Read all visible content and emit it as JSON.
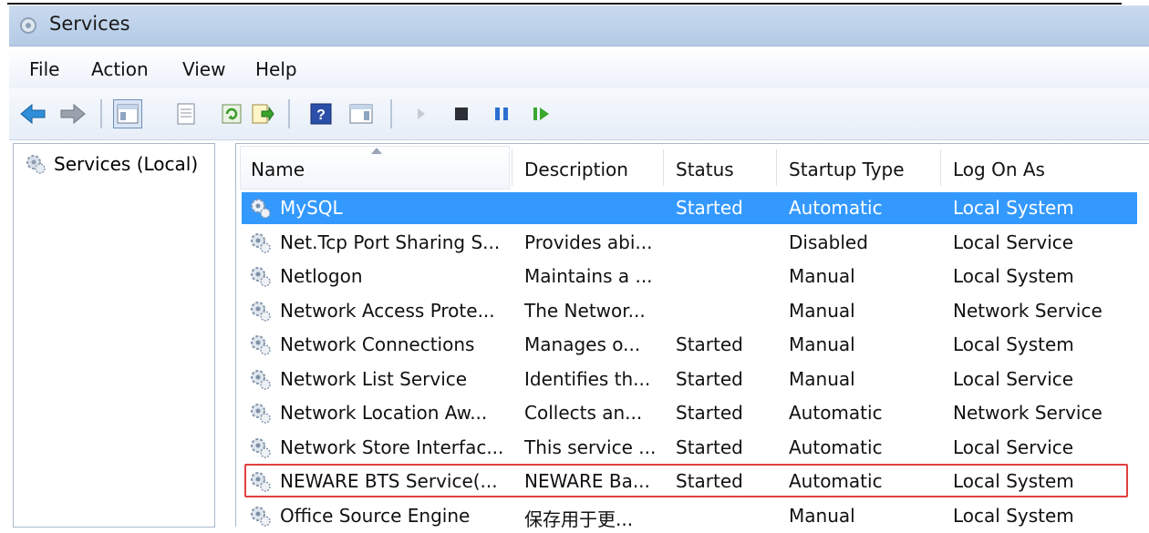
{
  "window": {
    "title": "Services"
  },
  "menu": [
    "File",
    "Action",
    "View",
    "Help"
  ],
  "left_pane": {
    "item": "Services (Local)"
  },
  "columns": [
    "Name",
    "Description",
    "Status",
    "Startup Type",
    "Log On As"
  ],
  "rows": [
    {
      "name": "MySQL",
      "description": "",
      "status": "Started",
      "startup": "Automatic",
      "logon": "Local System",
      "selected": true
    },
    {
      "name": "Net.Tcp Port Sharing S...",
      "description": "Provides abi...",
      "status": "",
      "startup": "Disabled",
      "logon": "Local Service"
    },
    {
      "name": "Netlogon",
      "description": "Maintains a ...",
      "status": "",
      "startup": "Manual",
      "logon": "Local System"
    },
    {
      "name": "Network Access Prote...",
      "description": "The Networ...",
      "status": "",
      "startup": "Manual",
      "logon": "Network Service"
    },
    {
      "name": "Network Connections",
      "description": "Manages o...",
      "status": "Started",
      "startup": "Manual",
      "logon": "Local System"
    },
    {
      "name": "Network List Service",
      "description": "Identifies th...",
      "status": "Started",
      "startup": "Manual",
      "logon": "Local Service"
    },
    {
      "name": "Network Location Aw...",
      "description": "Collects an...",
      "status": "Started",
      "startup": "Automatic",
      "logon": "Network Service"
    },
    {
      "name": "Network Store Interfac...",
      "description": "This service ...",
      "status": "Started",
      "startup": "Automatic",
      "logon": "Local Service"
    },
    {
      "name": "NEWARE BTS Service(...",
      "description": "NEWARE Ba...",
      "status": "Started",
      "startup": "Automatic",
      "logon": "Local System",
      "highlighted": true
    },
    {
      "name": "Office Source Engine",
      "description": "保存用于更...",
      "status": "",
      "startup": "Manual",
      "logon": "Local System"
    }
  ],
  "colors": {
    "selection": "#3399ff",
    "highlight_box": "#e04040",
    "titlebar": "#c9daee"
  }
}
